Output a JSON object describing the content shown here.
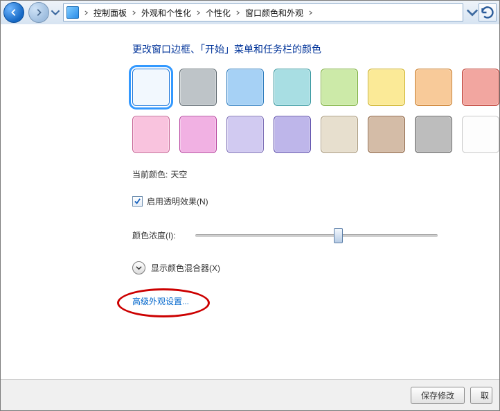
{
  "breadcrumb": {
    "items": [
      {
        "label": "控制面板"
      },
      {
        "label": "外观和个性化"
      },
      {
        "label": "个性化"
      },
      {
        "label": "窗口颜色和外观"
      }
    ]
  },
  "main": {
    "title": "更改窗口边框、「开始」菜单和任务栏的颜色",
    "current_color_label": "当前颜色:",
    "current_color_value": "天空",
    "transparency_checkbox": {
      "label": "启用透明效果(N)",
      "checked": true
    },
    "intensity_label": "颜色浓度(I):",
    "mixer_toggle": {
      "label": "显示颜色混合器(X)",
      "expanded": false
    },
    "advanced_link": "高级外观设置...",
    "swatches_row1": [
      {
        "name": "sky",
        "hex": "#bcdcf7",
        "selected": true,
        "lite": true
      },
      {
        "name": "graphite",
        "hex": "#6f7d86"
      },
      {
        "name": "blue",
        "hex": "#3b99e8"
      },
      {
        "name": "teal",
        "hex": "#3fb6c0"
      },
      {
        "name": "green",
        "hex": "#8fd13f"
      },
      {
        "name": "yellow",
        "hex": "#f6d11a"
      },
      {
        "name": "orange",
        "hex": "#f08a1d"
      },
      {
        "name": "red",
        "hex": "#e23b2e"
      }
    ],
    "swatches_row2": [
      {
        "name": "pink",
        "hex": "#f27bb6"
      },
      {
        "name": "fuchsia",
        "hex": "#e053c2"
      },
      {
        "name": "lavender",
        "hex": "#9a89e0"
      },
      {
        "name": "violet",
        "hex": "#6f5dd0"
      },
      {
        "name": "tan",
        "hex": "#cbb893"
      },
      {
        "name": "chocolate",
        "hex": "#a06a3d"
      },
      {
        "name": "slate",
        "hex": "#6d6d6d"
      },
      {
        "name": "frost",
        "hex": "#f4f4f4",
        "lite": true
      }
    ]
  },
  "footer": {
    "save": "保存修改",
    "cancel": "取"
  }
}
